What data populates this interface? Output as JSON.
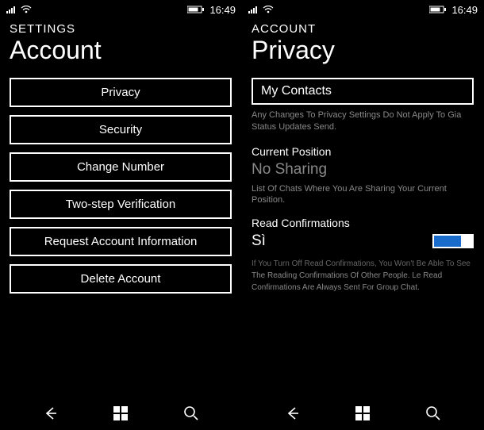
{
  "status": {
    "time": "16:49"
  },
  "left": {
    "breadcrumb": "SETTINGS",
    "title": "Account",
    "items": [
      "Privacy",
      "Security",
      "Change Number",
      "Two-step Verification",
      "Request Account Information",
      "Delete Account"
    ]
  },
  "right": {
    "breadcrumb": "ACCOUNT",
    "title": "Privacy",
    "contactsField": "My Contacts",
    "contactsHelp": "Any Changes To Privacy Settings Do Not Apply To Gia Status Updates Send.",
    "positionLabel": "Current Position",
    "positionValue": "No Sharing",
    "positionHelp": "List Of Chats Where You Are Sharing Your Current Position.",
    "readLabel": "Read Confirmations",
    "readValue": "Sì",
    "readHelp1": "If You Turn Off Read Confirmations, You Won't Be Able To See",
    "readHelp2": "The Reading Confirmations Of Other People. Le",
    "readHelp3": "Read Confirmations Are Always Sent For Group Chat."
  }
}
